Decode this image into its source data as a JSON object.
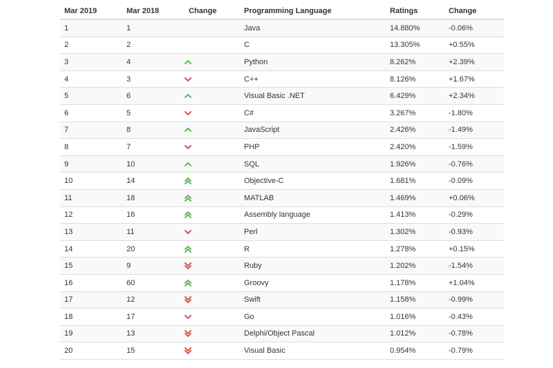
{
  "header": {
    "col_mar2019": "Mar 2019",
    "col_mar2018": "Mar 2018",
    "col_change_icon": "Change",
    "col_language": "Programming Language",
    "col_ratings": "Ratings",
    "col_change": "Change"
  },
  "colors": {
    "up": "#5cb85c",
    "down": "#d9534f",
    "row_odd": "#f9f9f9",
    "border": "#dddddd"
  },
  "rows": [
    {
      "mar2019": "1",
      "mar2018": "1",
      "trend": "none",
      "language": "Java",
      "rating": "14.880%",
      "change": "-0.06%"
    },
    {
      "mar2019": "2",
      "mar2018": "2",
      "trend": "none",
      "language": "C",
      "rating": "13.305%",
      "change": "+0.55%"
    },
    {
      "mar2019": "3",
      "mar2018": "4",
      "trend": "up",
      "language": "Python",
      "rating": "8.262%",
      "change": "+2.39%"
    },
    {
      "mar2019": "4",
      "mar2018": "3",
      "trend": "down",
      "language": "C++",
      "rating": "8.126%",
      "change": "+1.67%"
    },
    {
      "mar2019": "5",
      "mar2018": "6",
      "trend": "up",
      "language": "Visual Basic .NET",
      "rating": "6.429%",
      "change": "+2.34%"
    },
    {
      "mar2019": "6",
      "mar2018": "5",
      "trend": "down",
      "language": "C#",
      "rating": "3.267%",
      "change": "-1.80%"
    },
    {
      "mar2019": "7",
      "mar2018": "8",
      "trend": "up",
      "language": "JavaScript",
      "rating": "2.426%",
      "change": "-1.49%"
    },
    {
      "mar2019": "8",
      "mar2018": "7",
      "trend": "down",
      "language": "PHP",
      "rating": "2.420%",
      "change": "-1.59%"
    },
    {
      "mar2019": "9",
      "mar2018": "10",
      "trend": "up",
      "language": "SQL",
      "rating": "1.926%",
      "change": "-0.76%"
    },
    {
      "mar2019": "10",
      "mar2018": "14",
      "trend": "double-up",
      "language": "Objective-C",
      "rating": "1.681%",
      "change": "-0.09%"
    },
    {
      "mar2019": "11",
      "mar2018": "18",
      "trend": "double-up",
      "language": "MATLAB",
      "rating": "1.469%",
      "change": "+0.06%"
    },
    {
      "mar2019": "12",
      "mar2018": "16",
      "trend": "double-up",
      "language": "Assembly language",
      "rating": "1.413%",
      "change": "-0.29%"
    },
    {
      "mar2019": "13",
      "mar2018": "11",
      "trend": "down",
      "language": "Perl",
      "rating": "1.302%",
      "change": "-0.93%"
    },
    {
      "mar2019": "14",
      "mar2018": "20",
      "trend": "double-up",
      "language": "R",
      "rating": "1.278%",
      "change": "+0.15%"
    },
    {
      "mar2019": "15",
      "mar2018": "9",
      "trend": "double-down",
      "language": "Ruby",
      "rating": "1.202%",
      "change": "-1.54%"
    },
    {
      "mar2019": "16",
      "mar2018": "60",
      "trend": "double-up",
      "language": "Groovy",
      "rating": "1.178%",
      "change": "+1.04%"
    },
    {
      "mar2019": "17",
      "mar2018": "12",
      "trend": "double-down",
      "language": "Swift",
      "rating": "1.158%",
      "change": "-0.99%"
    },
    {
      "mar2019": "18",
      "mar2018": "17",
      "trend": "down",
      "language": "Go",
      "rating": "1.016%",
      "change": "-0.43%"
    },
    {
      "mar2019": "19",
      "mar2018": "13",
      "trend": "double-down",
      "language": "Delphi/Object Pascal",
      "rating": "1.012%",
      "change": "-0.78%"
    },
    {
      "mar2019": "20",
      "mar2018": "15",
      "trend": "double-down",
      "language": "Visual Basic",
      "rating": "0.954%",
      "change": "-0.79%"
    }
  ]
}
